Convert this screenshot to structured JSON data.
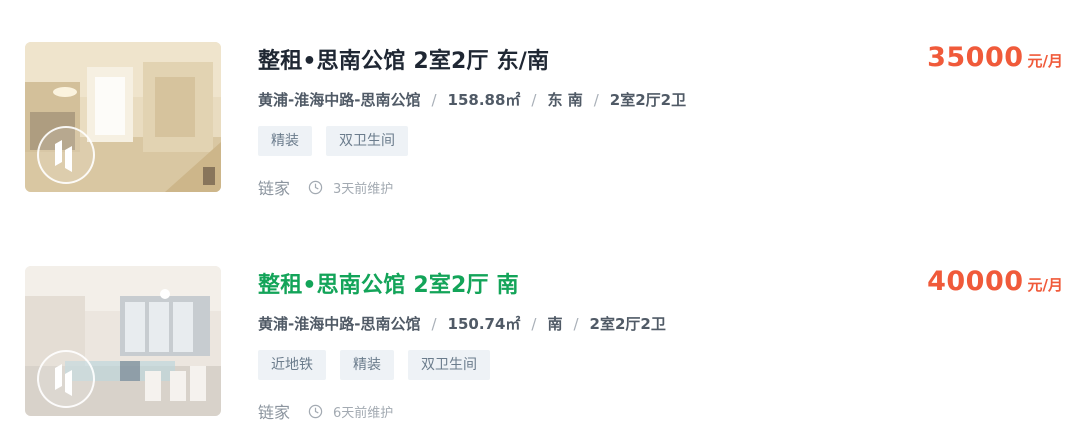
{
  "listings": [
    {
      "title": "整租•思南公馆 2室2厅 东/南",
      "area": "黄浦-淮海中路-思南公馆",
      "size": "158.88㎡",
      "orientation": "东 南",
      "layout": "2室2厅2卫",
      "tags": [
        "精装",
        "双卫生间"
      ],
      "agency": "链家",
      "updated": "3天前维护",
      "price": "35000",
      "price_unit": "元/月",
      "title_color": "#1f2733"
    },
    {
      "title": "整租•思南公馆 2室2厅 南",
      "area": "黄浦-淮海中路-思南公馆",
      "size": "150.74㎡",
      "orientation": "南",
      "layout": "2室2厅2卫",
      "tags": [
        "近地铁",
        "精装",
        "双卫生间"
      ],
      "agency": "链家",
      "updated": "6天前维护",
      "price": "40000",
      "price_unit": "元/月",
      "title_color": "#13a459"
    }
  ],
  "separator": "/",
  "icons": {
    "vr": "vr-play-icon",
    "clock": "clock-icon"
  },
  "colors": {
    "price": "#f05a3a",
    "title": "#1f2733",
    "title_hover": "#13a459",
    "tag_bg": "#eef2f6"
  }
}
